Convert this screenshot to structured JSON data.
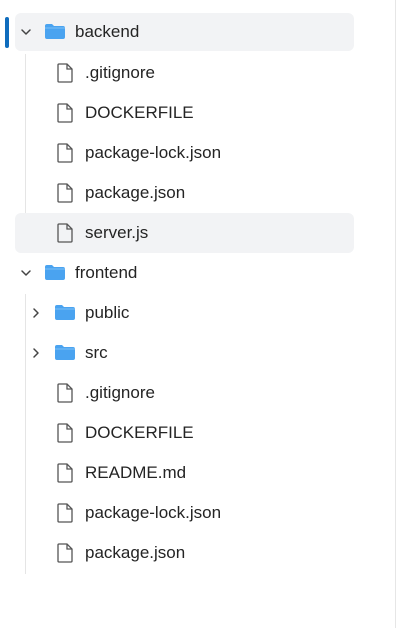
{
  "tree": {
    "backend": {
      "label": "backend",
      "icon": "folder-icon",
      "expanded": true,
      "children": [
        ".gitignore",
        "DOCKERFILE",
        "package-lock.json",
        "package.json",
        "server.js"
      ]
    },
    "frontend": {
      "label": "frontend",
      "icon": "folder-icon",
      "expanded": true,
      "folders": [
        "public",
        "src"
      ],
      "files": [
        ".gitignore",
        "DOCKERFILE",
        "README.md",
        "package-lock.json",
        "package.json"
      ]
    }
  },
  "colors": {
    "folder": "#4aa3f0",
    "accent": "#0f6cbd",
    "hover_bg": "#f2f3f5",
    "text": "#242424"
  }
}
